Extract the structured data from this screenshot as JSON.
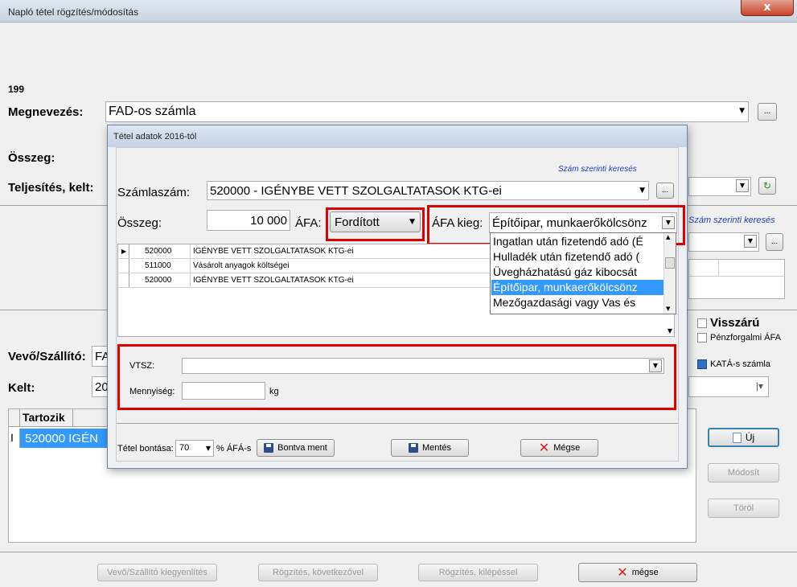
{
  "window": {
    "title": "Napló tétel rögzítés/módosítás",
    "close": "x"
  },
  "main": {
    "record_no": "199",
    "megnevezes_label": "Megnevezés:",
    "megnevezes_value": "FAD-os számla",
    "osszeg_label": "Összeg:",
    "teljesites_label": "Teljesítés, kelt:",
    "szam_search_partial": "Szám szerinti keresés",
    "vevo_label": "Vevő/Szállító:",
    "vevo_value_partial": "FA",
    "kelt_label": "Kelt:",
    "kelt_value_partial": "20",
    "visszaru_label": "Visszárú",
    "penzforgalmi_label": "Pénzforgalmi ÁFA",
    "kata_label": "KATÁ-s számla",
    "table_header": "Tartozik",
    "table_row_indicator": "I",
    "table_row_code": "520000",
    "table_row_name_partial": "IGÉN",
    "btn_uj": "Új",
    "btn_modosit": "Módosít",
    "btn_torol": "Töröl",
    "btn_kiegyenlites": "Vevő/Szállító kiegyenlítés",
    "btn_rogzites_kov": "Rögzítés, következővel",
    "btn_rogzites_kil": "Rögzítés, kilépéssel",
    "btn_megse": "mégse",
    "dots": "..."
  },
  "dialog": {
    "title": "Tétel adatok 2016-tól",
    "szam_search": "Szám szerinti keresés",
    "szamlaszam_label": "Számlaszám:",
    "szamlaszam_value": "520000 - IGÉNYBE VETT SZOLGALTATASOK KTG-ei",
    "osszeg_label": "Összeg:",
    "osszeg_value": "10 000",
    "afa_label": "ÁFA:",
    "afa_value": "Fordított",
    "afakieg_label": "ÁFA kieg:",
    "afakieg_value": "Építőipar, munkaerőkölcsönz",
    "afakieg_options": [
      "Ingatlan után fizetendő adó (É",
      "Hulladék után fizetendő adó (",
      "Üvegházhatású gáz kibocsát",
      "Építőipar, munkaerőkölcsönz",
      "Mezőgazdasági vagy Vas és"
    ],
    "grid_rows": [
      {
        "ind": "▶",
        "code": "520000",
        "name": "IGÉNYBE VETT SZOLGALTATASOK KTG-ei"
      },
      {
        "ind": "",
        "code": "511000",
        "name": "Vásárolt anyagok költségei"
      },
      {
        "ind": "",
        "code": "520000",
        "name": "IGÉNYBE VETT SZOLGALTATASOK KTG-ei"
      }
    ],
    "vtsz_label": "VTSZ:",
    "mennyiseg_label": "Mennyiség:",
    "mennyiseg_unit": "kg",
    "bontasa_label": "Tétel bontása:",
    "bontasa_value": "70",
    "bontasa_unit": "% ÁFÁ-s",
    "btn_bontva": "Bontva ment",
    "btn_mentes": "Mentés",
    "btn_megse": "Mégse",
    "dots": "..."
  },
  "colors": {
    "highlight_red": "#e00000",
    "selection_blue": "#3399ff",
    "link_blue": "#1f3fbf"
  }
}
